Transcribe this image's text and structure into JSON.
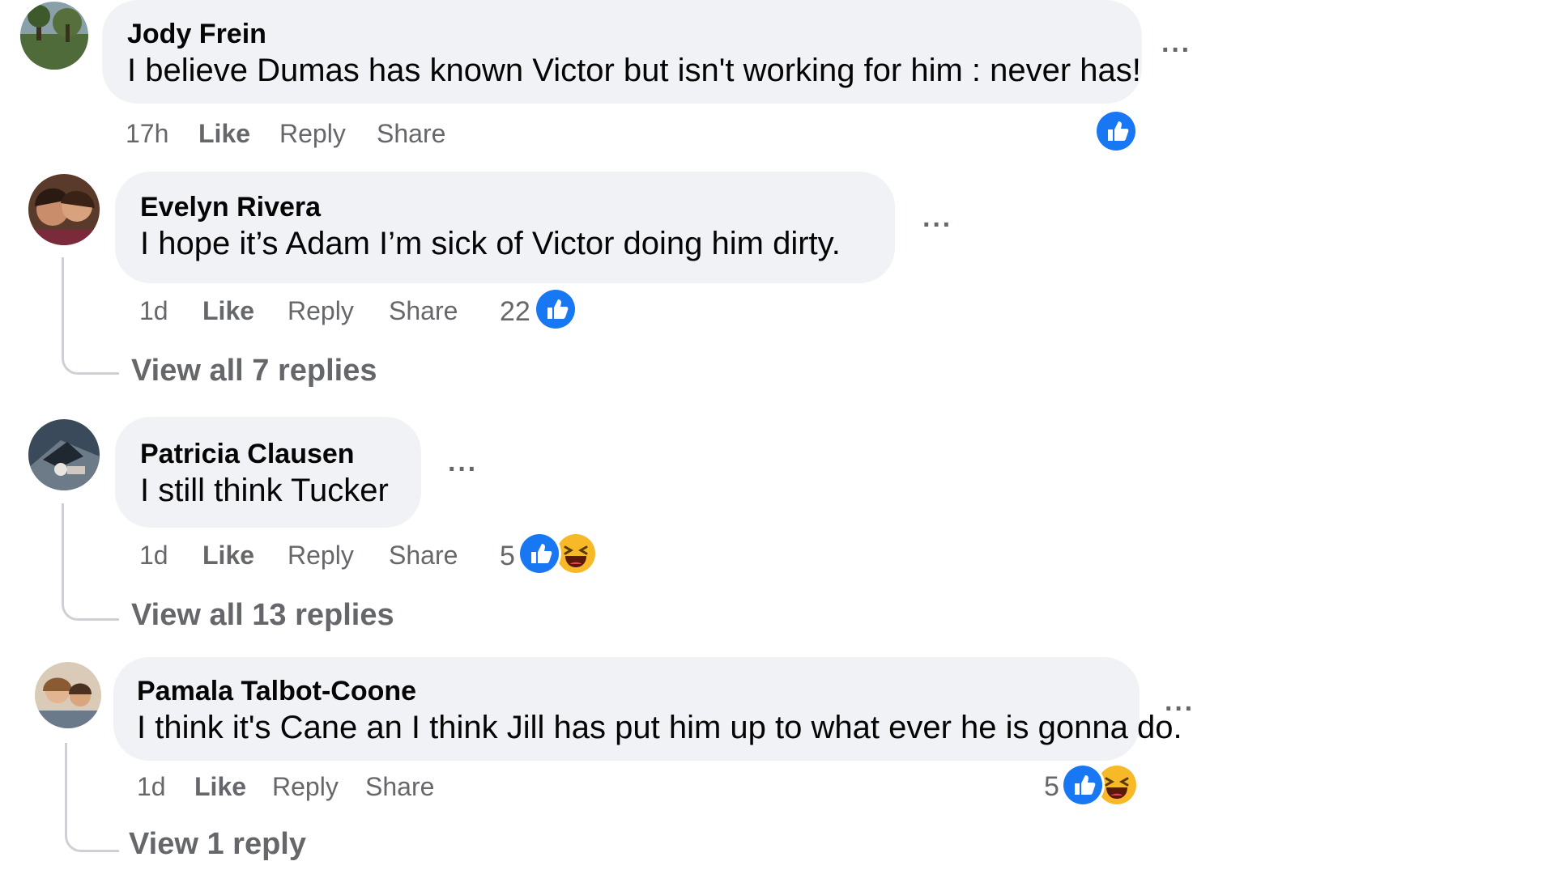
{
  "comments": [
    {
      "author": "Jody Frein",
      "text": "I believe Dumas has known Victor but isn't working for him : never has!",
      "time": "17h",
      "like": "Like",
      "reply": "Reply",
      "share": "Share",
      "reaction_count": "",
      "reactions": [
        "like-icon"
      ],
      "more": "···"
    },
    {
      "author": "Evelyn Rivera",
      "text": "I hope it’s Adam I’m sick of Victor doing him dirty.",
      "time": "1d",
      "like": "Like",
      "reply": "Reply",
      "share": "Share",
      "reaction_count": "22",
      "reactions": [
        "like-icon"
      ],
      "view_replies": "View all 7 replies",
      "more": "···"
    },
    {
      "author": "Patricia Clausen",
      "text": "I still think Tucker",
      "time": "1d",
      "like": "Like",
      "reply": "Reply",
      "share": "Share",
      "reaction_count": "5",
      "reactions": [
        "like-icon",
        "haha-icon"
      ],
      "view_replies": "View all 13 replies",
      "more": "···"
    },
    {
      "author": "Pamala Talbot-Coone",
      "text": "I think it's Cane an I think Jill has put him up to what ever he is gonna do.",
      "time": "1d",
      "like": "Like",
      "reply": "Reply",
      "share": "Share",
      "reaction_count": "5",
      "reactions": [
        "like-icon",
        "haha-icon"
      ],
      "view_replies": "View 1 reply",
      "more": "···"
    }
  ],
  "colors": {
    "bubble": "#f0f2f5",
    "secondary_text": "#65676b",
    "like_blue": "#1877f2",
    "haha_yellow": "#f7b928"
  }
}
